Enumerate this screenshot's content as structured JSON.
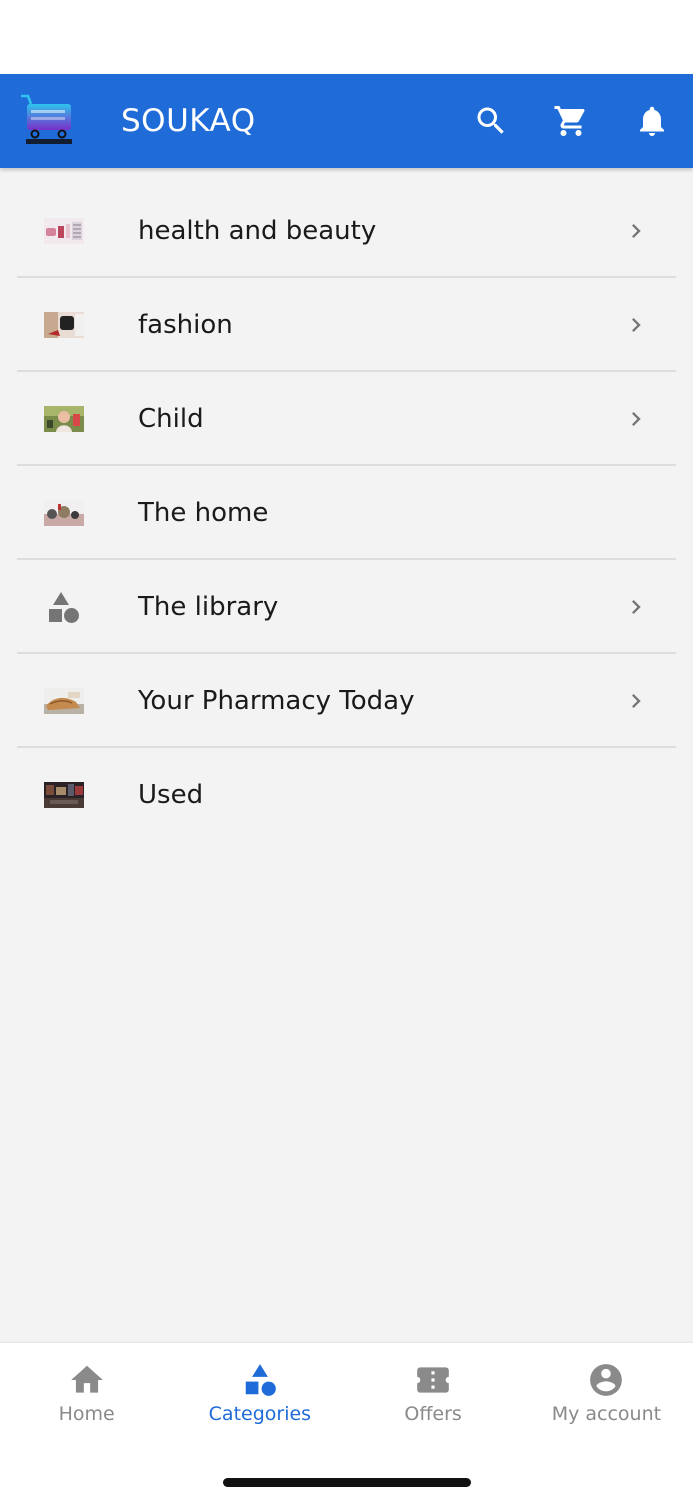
{
  "app": {
    "title": "SOUKAQ",
    "logo_text": "SOUKAQ",
    "accent_color": "#1f6cd9"
  },
  "toolbar": {
    "icons": [
      "search-icon",
      "cart-icon",
      "bell-icon"
    ]
  },
  "categories": [
    {
      "label": "health and beauty",
      "thumbnail": "photo",
      "has_children": true
    },
    {
      "label": "fashion",
      "thumbnail": "photo",
      "has_children": true
    },
    {
      "label": "Child",
      "thumbnail": "photo",
      "has_children": true
    },
    {
      "label": "The home",
      "thumbnail": "photo",
      "has_children": false
    },
    {
      "label": "The library",
      "thumbnail": "shapes-icon",
      "has_children": true
    },
    {
      "label": "Your Pharmacy Today",
      "thumbnail": "photo",
      "has_children": true
    },
    {
      "label": "Used",
      "thumbnail": "photo",
      "has_children": false
    }
  ],
  "bottom_nav": {
    "items": [
      {
        "label": "Home",
        "icon": "home-icon",
        "active": false
      },
      {
        "label": "Categories",
        "icon": "categories-icon",
        "active": true
      },
      {
        "label": "Offers",
        "icon": "ticket-icon",
        "active": false
      },
      {
        "label": "My account",
        "icon": "account-icon",
        "active": false
      }
    ]
  }
}
